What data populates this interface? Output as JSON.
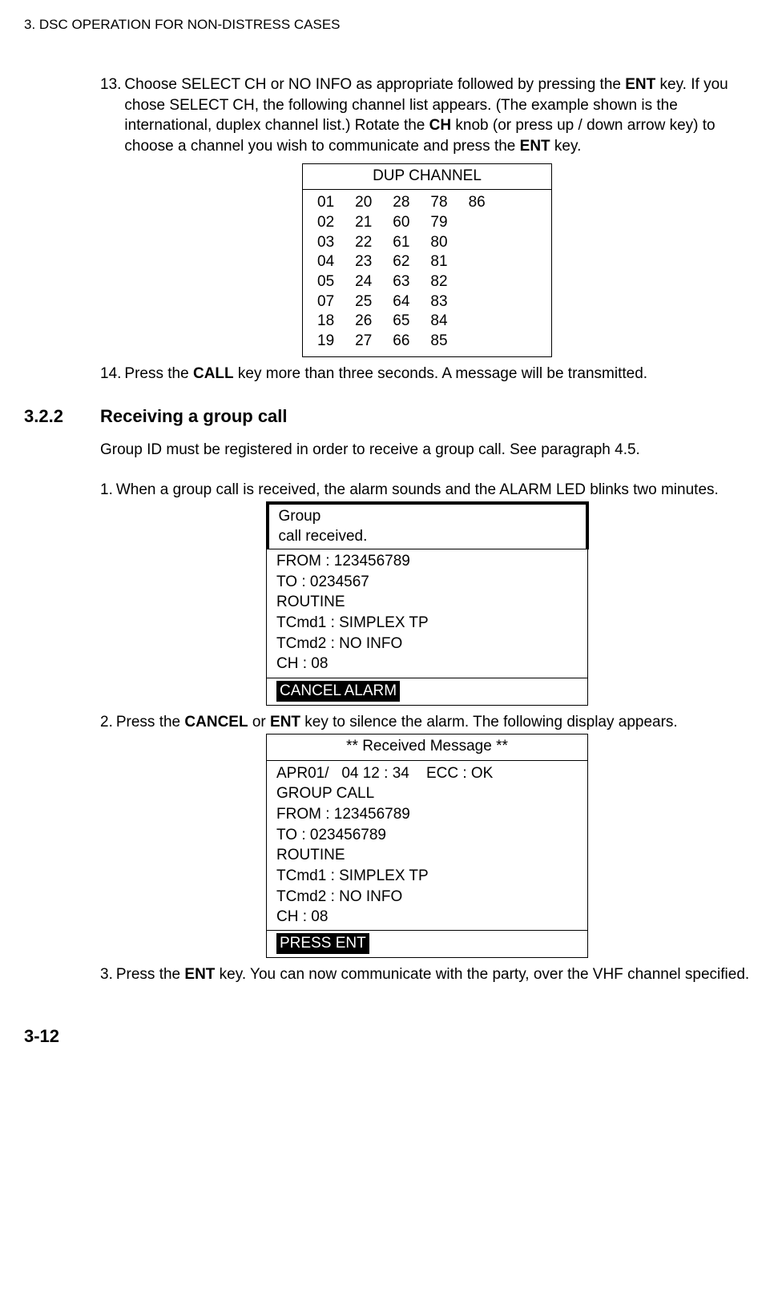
{
  "header": "3. DSC OPERATION FOR NON-DISTRESS CASES",
  "step13": {
    "num": "13.",
    "text_before": "Choose SELECT CH or NO INFO as appropriate followed by pressing the ",
    "ent1": "ENT",
    "text_mid1": " key. If you chose SELECT CH, the following channel list appears. (The example shown is the international, duplex channel list.) Rotate the ",
    "ch_bold": "CH",
    "text_mid2": " knob (or press up / down arrow key) to choose a channel you wish to communicate and press the ",
    "ent2": "ENT",
    "text_end": " key."
  },
  "dup": {
    "title": "DUP CHANNEL",
    "col1": [
      "01",
      "02",
      "03",
      "04",
      "05",
      "07",
      "18",
      "19"
    ],
    "col2": [
      "20",
      "21",
      "22",
      "23",
      "24",
      "25",
      "26",
      "27"
    ],
    "col3": [
      "28",
      "60",
      "61",
      "62",
      "63",
      "64",
      "65",
      "66"
    ],
    "col4": [
      "78",
      "79",
      "80",
      "81",
      "82",
      "83",
      "84",
      "85"
    ],
    "col5": [
      "86"
    ]
  },
  "step14": {
    "num": "14.",
    "t1": "Press the ",
    "call_bold": "CALL",
    "t2": " key more than three seconds. A message will be transmitted."
  },
  "section": {
    "num": "3.2.2",
    "title": "Receiving a group call"
  },
  "intro": "Group ID must be registered in order to receive a group call. See paragraph 4.5.",
  "step1": {
    "num": "1.",
    "text": "When a group call is received, the alarm sounds and the ALARM LED blinks two minutes."
  },
  "alarm_screen": {
    "l1": "Group",
    "l2": "call received.",
    "from": "FROM : 123456789",
    "to": "TO : 0234567",
    "routine": "ROUTINE",
    "tc1": "TCmd1 : SIMPLEX TP",
    "tc2": "TCmd2 : NO INFO",
    "ch": "CH : 08",
    "cancel": "CANCEL ALARM"
  },
  "step2": {
    "num": "2.",
    "t1": "Press the ",
    "b1": "CANCEL",
    "t2": " or ",
    "b2": "ENT",
    "t3": " key to silence the alarm. The following display appears."
  },
  "rm_screen": {
    "title": "** Received Message **",
    "dt": "APR01/   04 12 : 34    ECC : OK",
    "type": "GROUP CALL",
    "from": "FROM : 123456789",
    "to": "TO : 023456789",
    "routine": "ROUTINE",
    "tc1": "TCmd1 : SIMPLEX TP",
    "tc2": "TCmd2 : NO INFO",
    "ch": "CH : 08",
    "press": "PRESS ENT"
  },
  "step3": {
    "num": "3.",
    "t1": "Press the ",
    "b1": "ENT",
    "t2": " key. You can now communicate with the party, over the VHF channel specified."
  },
  "page_number": "3-12"
}
